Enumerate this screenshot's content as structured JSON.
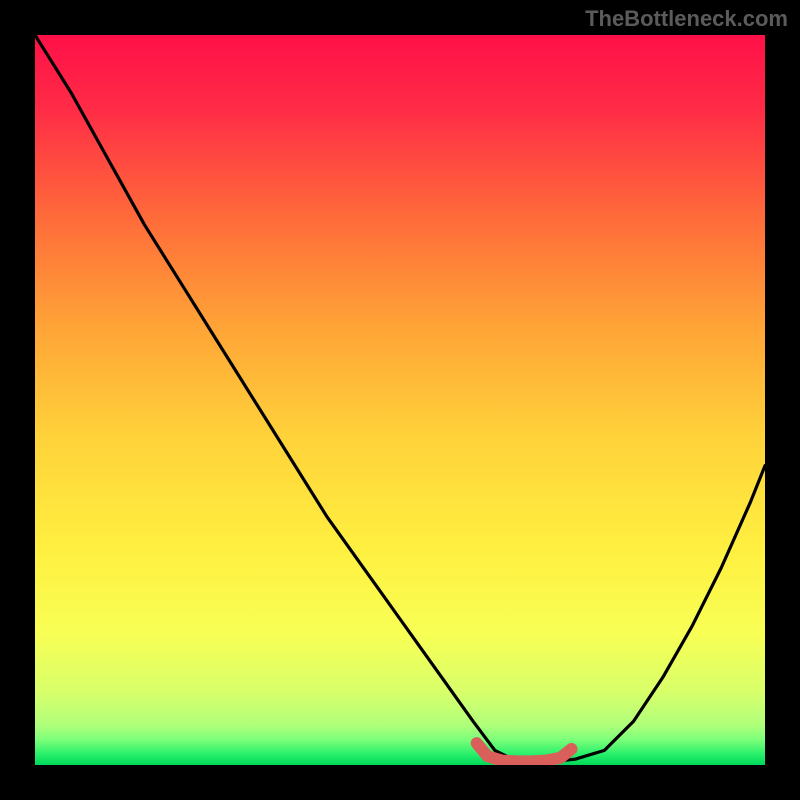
{
  "watermark": "TheBottleneck.com",
  "colors": {
    "gradient_top": "#ff1a4a",
    "gradient_mid": "#ffe23a",
    "gradient_bottom": "#00e05a",
    "curve": "#000000",
    "marker": "#d9605a",
    "background": "#000000"
  },
  "chart_data": {
    "type": "line",
    "title": "",
    "xlabel": "",
    "ylabel": "",
    "xlim": [
      0,
      100
    ],
    "ylim": [
      0,
      100
    ],
    "series": [
      {
        "name": "bottleneck-curve",
        "x": [
          0,
          5,
          10,
          15,
          20,
          25,
          30,
          35,
          40,
          45,
          50,
          55,
          60,
          63,
          66,
          71,
          74,
          78,
          82,
          86,
          90,
          94,
          98,
          100
        ],
        "y": [
          100,
          92,
          83,
          74,
          66,
          58,
          50,
          42,
          34,
          27,
          20,
          13,
          6,
          2,
          0.5,
          0.5,
          0.8,
          2,
          6,
          12,
          19,
          27,
          36,
          41
        ]
      }
    ],
    "marker_segment": {
      "name": "highlight-range",
      "x": [
        60.5,
        62,
        64,
        66,
        68,
        70,
        72,
        73.5
      ],
      "y": [
        3.0,
        1.2,
        0.6,
        0.5,
        0.5,
        0.6,
        1.0,
        2.2
      ]
    },
    "annotations": []
  }
}
